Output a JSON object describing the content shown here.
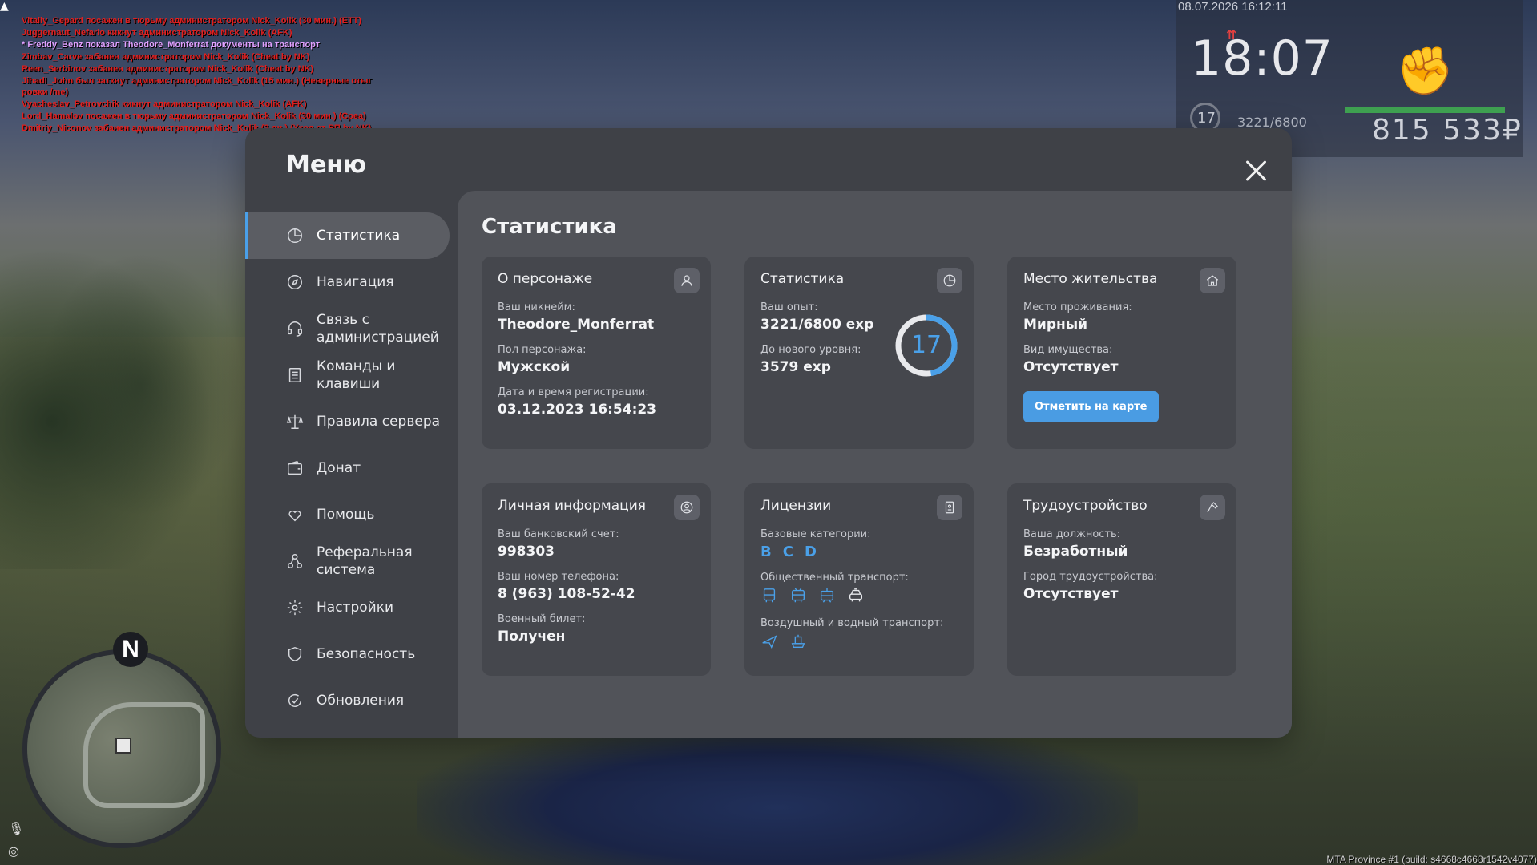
{
  "chat": [
    {
      "text": "Vitaliy_Gepard посажен в тюрьму администратором Nick_Kolik (30 мин.) (ETT)",
      "color": "red"
    },
    {
      "text": "Juggernaut_Nefario кикнут администратором Nick_Kolik (AFK)",
      "color": "red"
    },
    {
      "text": "* Freddy_Benz показал Theodore_Monferrat документы на транспорт",
      "color": "purple"
    },
    {
      "text": "Zimbav_Carve забанен администратором Nick_Kolik (Cheat by NK)",
      "color": "red"
    },
    {
      "text": "Reen_Serbinov забанен администратором Nick_Kolik (Cheat by NK)",
      "color": "red"
    },
    {
      "text": "Jihadi_John был заткнут администратором Nick_Kolik (15 мин.) (Неверные отыг",
      "color": "red"
    },
    {
      "text": "ровки /me)",
      "color": "red"
    },
    {
      "text": "Vyacheslav_Petrovchik кикнут администратором Nick_Kolik (AFK)",
      "color": "red"
    },
    {
      "text": "Lord_Hamalov посажен в тюрьму администратором Nick_Kolik (30 мин.) (Cpea)",
      "color": "red"
    },
    {
      "text": "Dmitriy_Niconov забанен администратором Nick_Kolik (3 дн.) (Уход от РП by NK)",
      "color": "red"
    }
  ],
  "hud": {
    "date": "08.07.2026 16:12:11",
    "time": "18:07",
    "level": "17",
    "exp": "3221/6800",
    "money": "815 533₽",
    "fist_icon": "fist-icon",
    "health_color": "#3ea050"
  },
  "minimap": {
    "north_label": "N"
  },
  "build": "MTA Province #1 (build: s4668c4668r1542v4077)",
  "menu": {
    "title": "Меню",
    "accent": "#4aa0e8",
    "sidebar": [
      {
        "label": "Статистика",
        "icon": "pie-chart-icon",
        "active": true
      },
      {
        "label": "Навигация",
        "icon": "compass-icon"
      },
      {
        "label": "Связь с администрацией",
        "icon": "headset-icon"
      },
      {
        "label": "Команды и клавиши",
        "icon": "keyboard-list-icon"
      },
      {
        "label": "Правила сервера",
        "icon": "scales-icon"
      },
      {
        "label": "Донат",
        "icon": "wallet-icon"
      },
      {
        "label": "Помощь",
        "icon": "heart-hand-icon"
      },
      {
        "label": "Реферальная система",
        "icon": "referral-icon"
      },
      {
        "label": "Настройки",
        "icon": "gear-icon"
      },
      {
        "label": "Безопасность",
        "icon": "shield-icon"
      },
      {
        "label": "Обновления",
        "icon": "refresh-check-icon"
      }
    ],
    "content_title": "Статистика",
    "cards": {
      "character": {
        "title": "О персонаже",
        "nick_label": "Ваш никнейм:",
        "nick": "Theodore_Monferrat",
        "gender_label": "Пол персонажа:",
        "gender": "Мужской",
        "reg_label": "Дата и время регистрации:",
        "reg": "03.12.2023 16:54:23"
      },
      "stats": {
        "title": "Статистика",
        "exp_label": "Ваш опыт:",
        "exp": "3221/6800 exp",
        "next_label": "До нового уровня:",
        "next": "3579 exp",
        "level": "17",
        "progress": 0.4737
      },
      "residence": {
        "title": "Место жительства",
        "place_label": "Место проживания:",
        "place": "Мирный",
        "property_label": "Вид имущества:",
        "property": "Отсутствует",
        "button": "Отметить на карте"
      },
      "personal": {
        "title": "Личная информация",
        "bank_label": "Ваш банковский счет:",
        "bank": "998303",
        "phone_label": "Ваш номер телефона:",
        "phone": "8 (963) 108-52-42",
        "military_label": "Военный билет:",
        "military": "Получен"
      },
      "licenses": {
        "title": "Лицензии",
        "base_label": "Базовые категории:",
        "categories": [
          "B",
          "C",
          "D"
        ],
        "public_label": "Общественный транспорт:",
        "air_label": "Воздушный и водный транспорт:"
      },
      "employment": {
        "title": "Трудоустройство",
        "position_label": "Ваша должность:",
        "position": "Безработный",
        "city_label": "Город трудоустройства:",
        "city": "Отсутствует"
      }
    }
  }
}
